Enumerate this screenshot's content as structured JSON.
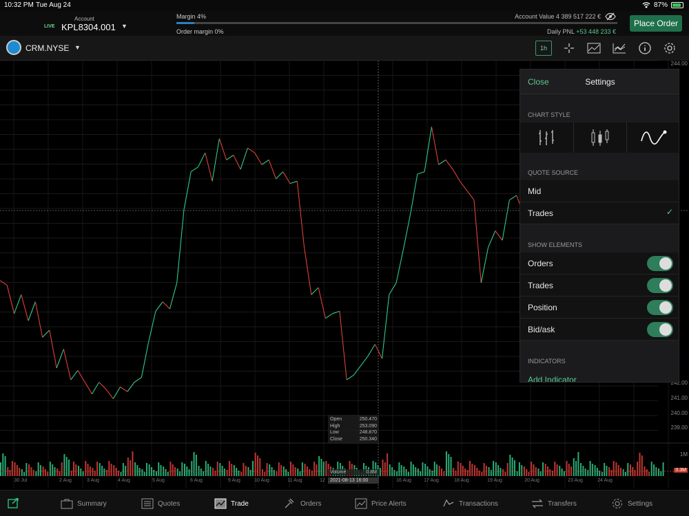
{
  "status": {
    "time": "10:32 PM",
    "date": "Tue Aug 24",
    "battery": "87%"
  },
  "header": {
    "account_label": "Account",
    "live_badge": "LIVE",
    "account_id": "KPL8304.001",
    "margin_label": "Margin 4%",
    "margin_fraction": 0.04,
    "order_margin_label": "Order margin 0%",
    "account_value": "Account Value 4 389 517 222 €",
    "daily_pnl_label": "Daily PNL",
    "daily_pnl_value": "+53 448 233 €",
    "place_order": "Place Order"
  },
  "instrument": {
    "name": "CRM.NYSE",
    "timeframe": "1h"
  },
  "chart_data": {
    "type": "line",
    "y_ticks": [
      "244.00",
      "242.00",
      "241.00",
      "240.00",
      "239.00"
    ],
    "x_ticks": [
      "30 Jul",
      "2 Aug",
      "3 Aug",
      "4 Aug",
      "5 Aug",
      "6 Aug",
      "9 Aug",
      "10 Aug",
      "11 Aug",
      "12",
      "16 Aug",
      "17 Aug",
      "18 Aug",
      "19 Aug",
      "20 Aug",
      "23 Aug",
      "24 Aug"
    ],
    "volume_ticks": [
      "1M"
    ],
    "ylim": [
      238.5,
      254.5
    ],
    "y": [
      245.2,
      245.0,
      243.8,
      244.6,
      243.5,
      244.3,
      242.8,
      243.1,
      241.5,
      242.3,
      241.0,
      241.4,
      240.9,
      240.4,
      240.9,
      240.6,
      240.2,
      240.7,
      240.5,
      240.9,
      241.1,
      242.6,
      243.9,
      244.3,
      244.0,
      245.1,
      248.2,
      249.8,
      250.0,
      250.6,
      249.4,
      251.2,
      250.3,
      250.5,
      249.9,
      250.8,
      250.6,
      250.1,
      250.3,
      249.5,
      249.8,
      249.3,
      249.4,
      246.6,
      244.6,
      244.9,
      243.6,
      243.8,
      243.9,
      241.0,
      241.2,
      241.6,
      242.0,
      242.5,
      241.9,
      244.6,
      245.1,
      246.5,
      248.0,
      249.7,
      249.8,
      251.7,
      250.1,
      250.3,
      249.9,
      249.4,
      249.0,
      248.6,
      245.1,
      246.6,
      247.3,
      246.9,
      248.6,
      248.8,
      248.0,
      246.9,
      247.4,
      246.6,
      246.4,
      247.0,
      246.9,
      247.8,
      248.6,
      249.2,
      252.5,
      253.0,
      249.0,
      247.5,
      249.2,
      249.0,
      248.3,
      247.3,
      251.0,
      252.4
    ],
    "ohlc": {
      "open_label": "Open",
      "open": "250.470",
      "high_label": "High",
      "high": "253.090",
      "low_label": "Low",
      "low": "248.870",
      "close_label": "Close",
      "close": "250.340"
    },
    "volume_label": "Volume",
    "volume_value": "0.8M",
    "volume_current": "0.3M",
    "crosshair_date": "2021-08-13 16:00",
    "colors": {
      "up": "#2ecc89",
      "down": "#e0413a"
    }
  },
  "settings": {
    "close": "Close",
    "title": "Settings",
    "chart_style_title": "CHART STYLE",
    "chart_styles": [
      "bar-chart-icon",
      "candlestick-icon",
      "line-chart-icon"
    ],
    "quote_source_title": "QUOTE SOURCE",
    "quote_sources": [
      {
        "label": "Mid",
        "selected": false
      },
      {
        "label": "Trades",
        "selected": true
      }
    ],
    "show_elements_title": "SHOW ELEMENTS",
    "elements": [
      {
        "label": "Orders",
        "on": true
      },
      {
        "label": "Trades",
        "on": true
      },
      {
        "label": "Position",
        "on": true
      },
      {
        "label": "Bid/ask",
        "on": true
      }
    ],
    "indicators_title": "INDICATORS",
    "add_indicator": "Add Indicator"
  },
  "nav": [
    {
      "label": "Summary",
      "icon": "briefcase-icon"
    },
    {
      "label": "Quotes",
      "icon": "list-icon"
    },
    {
      "label": "Trade",
      "icon": "chart-icon",
      "active": true
    },
    {
      "label": "Orders",
      "icon": "gavel-icon"
    },
    {
      "label": "Price Alerts",
      "icon": "alert-icon"
    },
    {
      "label": "Transactions",
      "icon": "transactions-icon"
    },
    {
      "label": "Transfers",
      "icon": "transfer-icon"
    },
    {
      "label": "Settings",
      "icon": "gear-icon"
    }
  ]
}
